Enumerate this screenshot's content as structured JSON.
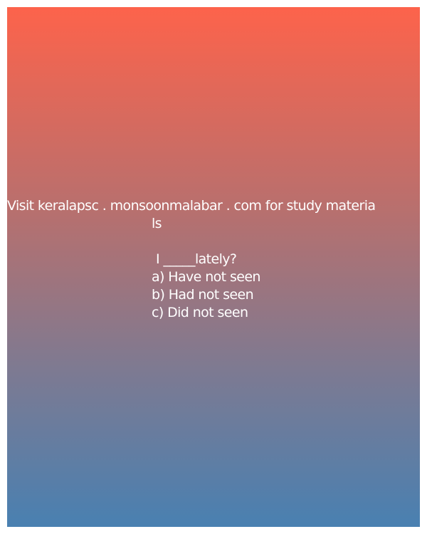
{
  "promo": {
    "line1": "Visit keralapsc . monsoonmalabar . com for study materia",
    "line2": "ls"
  },
  "question": {
    "text": "I _____lately?",
    "options": [
      "a) Have not seen",
      "b) Had not seen",
      "c) Did not seen"
    ]
  },
  "colors": {
    "gradient_top": "#fd634b",
    "gradient_bottom": "#4980b1",
    "text": "#ffffff",
    "page_background": "#ffffff"
  }
}
